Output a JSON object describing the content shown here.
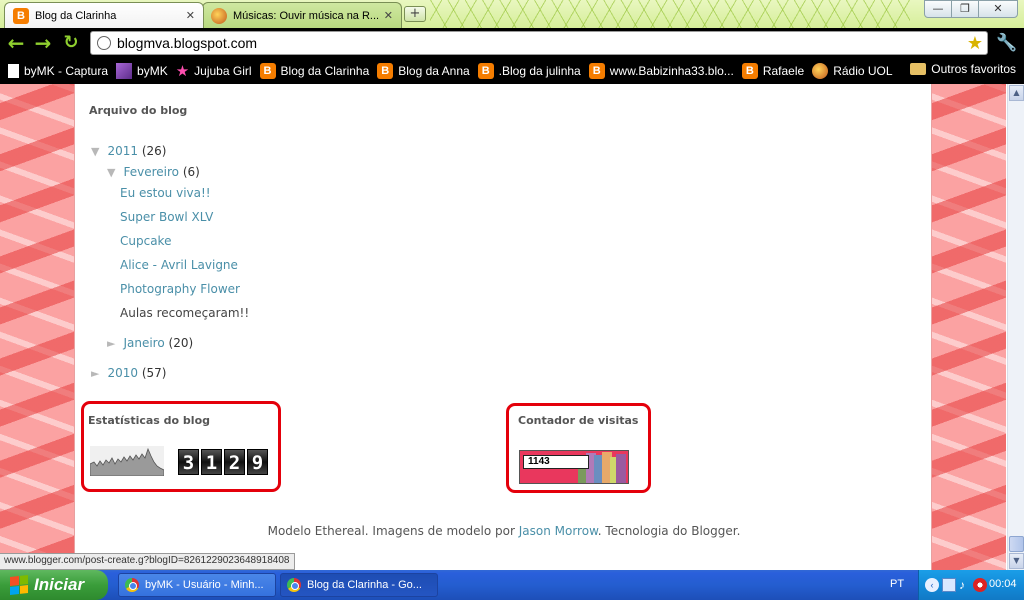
{
  "browser": {
    "tabs": [
      {
        "label": "Blog da Clarinha",
        "icon": "blogger-icon",
        "active": true
      },
      {
        "label": "Músicas: Ouvir música na R...",
        "icon": "radio-uol-icon",
        "active": false
      }
    ],
    "new_tab_glyph": "+",
    "window_controls": {
      "minimize": "—",
      "maximize": "❐",
      "close": "✕"
    },
    "toolbar": {
      "back_glyph": "←",
      "forward_glyph": "→",
      "reload_glyph": "↻",
      "url": "blogmva.blogspot.com",
      "star_glyph": "★",
      "wrench_glyph": "🔧"
    },
    "bookmarks": [
      {
        "label": "byMK - Captura",
        "icon": "document-icon"
      },
      {
        "label": "byMK",
        "icon": "bymk-icon"
      },
      {
        "label": "Jujuba Girl",
        "icon": "star-icon"
      },
      {
        "label": "Blog da Clarinha",
        "icon": "blogger-icon"
      },
      {
        "label": "Blog da Anna",
        "icon": "blogger-icon"
      },
      {
        "label": ".Blog da julinha",
        "icon": "blogger-icon"
      },
      {
        "label": "www.Babizinha33.blo...",
        "icon": "blogger-icon"
      },
      {
        "label": "Rafaele",
        "icon": "blogger-icon"
      },
      {
        "label": "Rádio UOL",
        "icon": "radio-uol-icon"
      }
    ],
    "other_bookmarks": "Outros favoritos",
    "status_url": "www.blogger.com/post-create.g?blogID=8261229023648918408"
  },
  "blog": {
    "archive": {
      "title": "Arquivo do blog",
      "toggle_open": "▼",
      "toggle_closed": "►",
      "years": [
        {
          "year": "2011",
          "count": "(26)",
          "months": [
            {
              "month": "Fevereiro",
              "count": "(6)",
              "posts": [
                {
                  "title": "Eu estou viva!!",
                  "current": false
                },
                {
                  "title": "Super Bowl XLV",
                  "current": false
                },
                {
                  "title": "Cupcake",
                  "current": false
                },
                {
                  "title": "Alice - Avril Lavigne",
                  "current": false
                },
                {
                  "title": "Photography Flower",
                  "current": false
                },
                {
                  "title": "Aulas recomeçaram!!",
                  "current": true
                }
              ]
            },
            {
              "month": "Janeiro",
              "count": "(20)"
            }
          ]
        },
        {
          "year": "2010",
          "count": "(57)"
        }
      ]
    },
    "stats": {
      "title": "Estatísticas do blog",
      "digits": [
        "3",
        "1",
        "2",
        "9"
      ]
    },
    "counter": {
      "title": "Contador de visitas",
      "value": "1143"
    },
    "footer": {
      "text1": "Modelo Ethereal. Imagens de modelo por ",
      "author_link": "Jason Morrow",
      "text2": ". Tecnologia do ",
      "blogger_link": "Blogger",
      "text3": "."
    }
  },
  "taskbar": {
    "start_label": "Iniciar",
    "tasks": [
      {
        "label": "byMK - Usuário - Minh...",
        "active": false
      },
      {
        "label": "Blog da Clarinha - Go...",
        "active": true
      }
    ],
    "language": "PT",
    "clock": "00:04"
  },
  "colors": {
    "accent_green": "#8fcf2f",
    "link_teal": "#4a8fa8",
    "highlight_red": "#e4000b",
    "blogger_orange": "#f57d00",
    "deco_pink": "#fba2a2"
  }
}
